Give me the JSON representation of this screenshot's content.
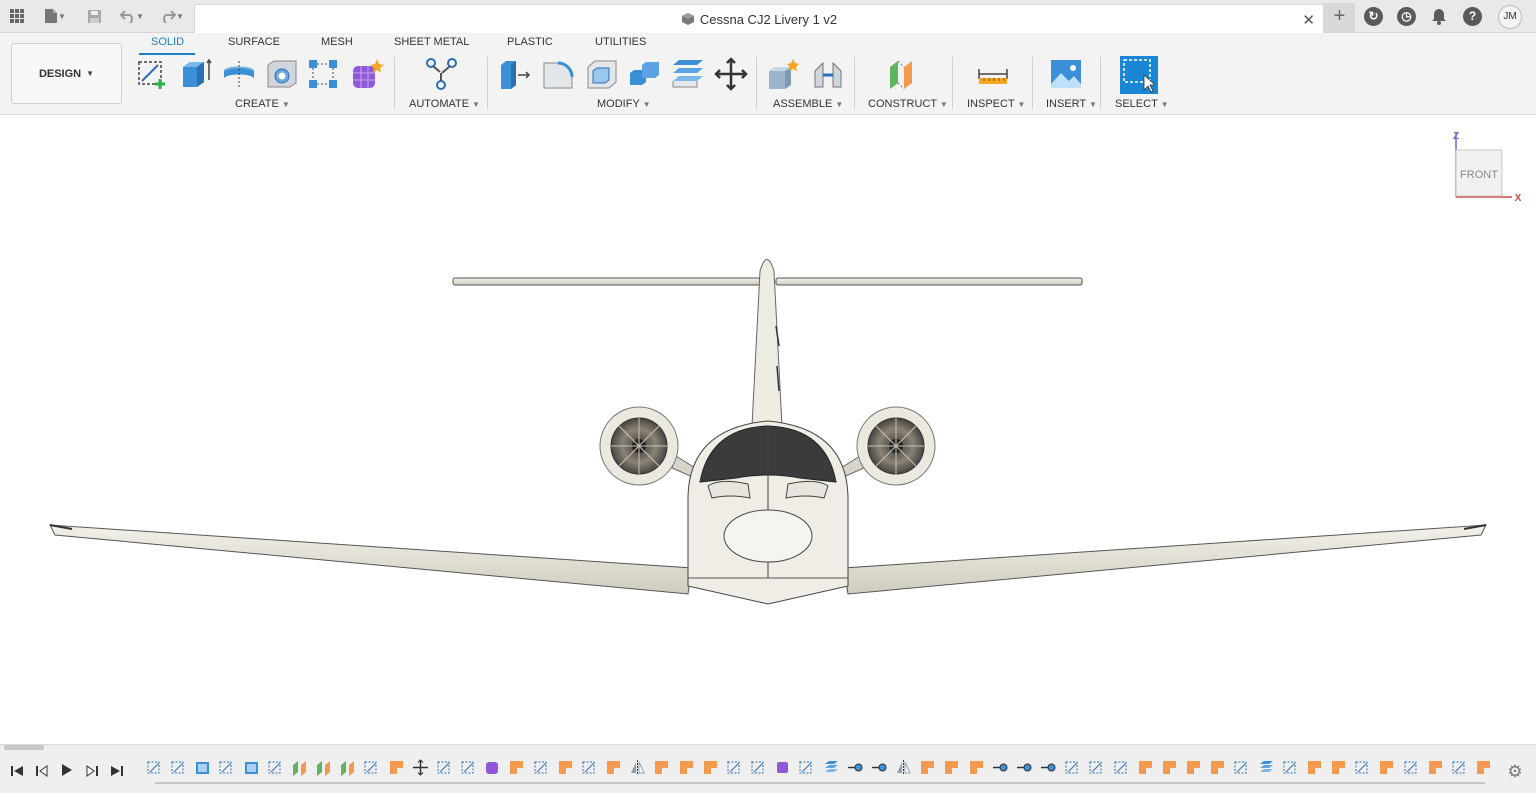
{
  "document": {
    "title": "Cessna CJ2 Livery 1 v2",
    "close_glyph": "✕",
    "new_tab_glyph": "+"
  },
  "topbar": {
    "icons": [
      "apps-grid-icon",
      "file-icon",
      "save-icon",
      "undo-icon",
      "redo-icon",
      "extensions-icon",
      "job-status-icon",
      "notifications-icon",
      "help-icon"
    ],
    "user_initials": "JM"
  },
  "workspace": {
    "label": "DESIGN"
  },
  "tabs": [
    {
      "label": "SOLID",
      "active": true
    },
    {
      "label": "SURFACE",
      "active": false
    },
    {
      "label": "MESH",
      "active": false
    },
    {
      "label": "SHEET METAL",
      "active": false
    },
    {
      "label": "PLASTIC",
      "active": false
    },
    {
      "label": "UTILITIES",
      "active": false
    }
  ],
  "groups": {
    "create": "CREATE",
    "automate": "AUTOMATE",
    "modify": "MODIFY",
    "assemble": "ASSEMBLE",
    "construct": "CONSTRUCT",
    "inspect": "INSPECT",
    "insert": "INSERT",
    "select": "SELECT"
  },
  "viewcube": {
    "face": "FRONT",
    "axis_z": "Z",
    "axis_x": "X"
  },
  "colors": {
    "accent": "#1a7ec8",
    "model_body": "#efede6",
    "feature_orange": "#f39a4e",
    "feature_blue": "#3a8fd6"
  },
  "timeline": {
    "controls": [
      "first-step-icon",
      "previous-step-icon",
      "play-icon",
      "next-step-icon",
      "last-step-icon"
    ],
    "feature_count": 56
  }
}
